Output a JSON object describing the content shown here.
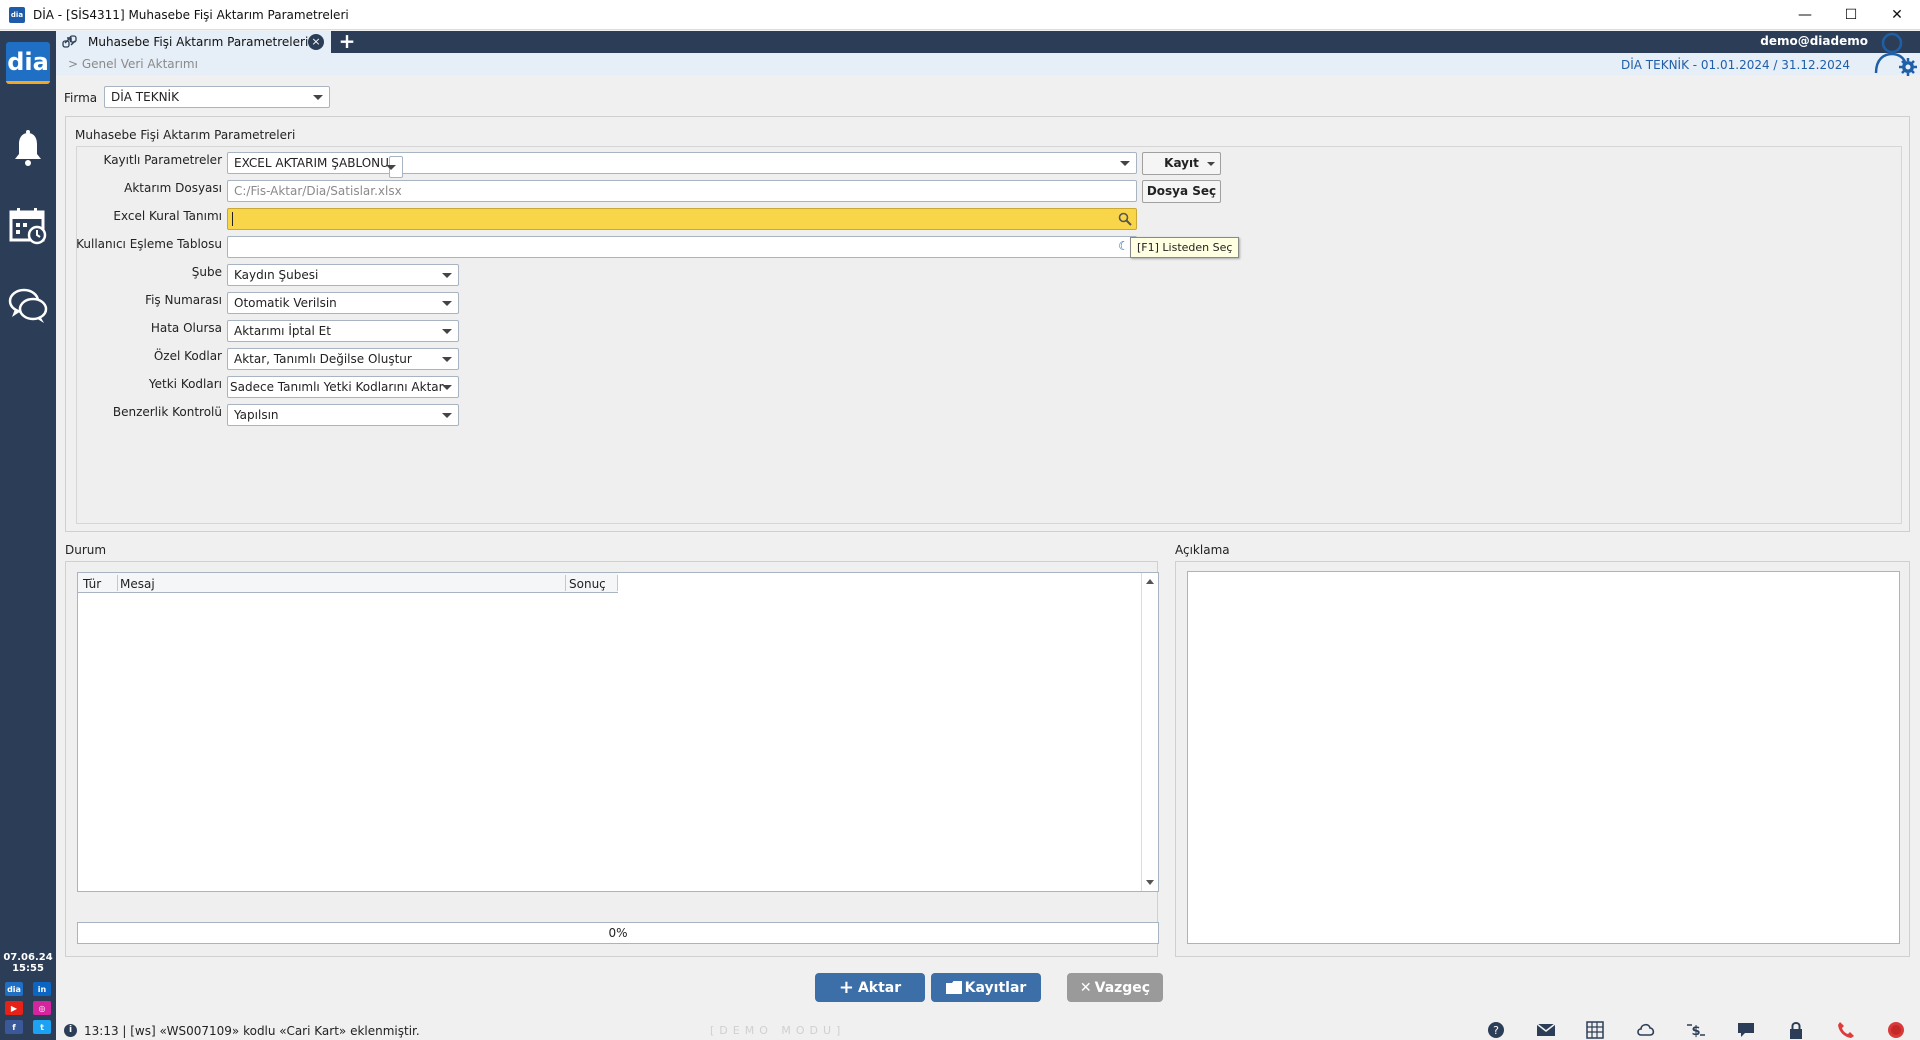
{
  "window": {
    "title": "DİA - [SİS4311] Muhasebe Fişi Aktarım Parametreleri",
    "app_icon_text": "dia",
    "min": "—",
    "max": "☐",
    "close": "✕"
  },
  "sidebar": {
    "logo": "dia",
    "date": "07.06.24",
    "time": "15:55",
    "icons": [
      "bell-icon",
      "calendar-clock-icon",
      "chat-icon"
    ],
    "social": [
      {
        "name": "dia",
        "text": "dia",
        "color": "#1f6fc4"
      },
      {
        "name": "linkedin",
        "text": "in",
        "color": "#0a66c2"
      },
      {
        "name": "youtube",
        "text": "▶",
        "color": "#e62117"
      },
      {
        "name": "instagram",
        "text": "◎",
        "color": "#d6249f"
      },
      {
        "name": "facebook",
        "text": "f",
        "color": "#3b5998"
      },
      {
        "name": "twitter",
        "text": "t",
        "color": "#1da1f2"
      }
    ]
  },
  "tabs": {
    "active_label": "Muhasebe Fişi Aktarım Parametreleri",
    "close": "×",
    "add": "+"
  },
  "user": {
    "name": "demo@diademo"
  },
  "breadcrumb": "> Genel Veri Aktarımı",
  "period": "DİA TEKNİK -  01.01.2024 / 31.12.2024",
  "firma": {
    "label": "Firma",
    "value": "DİA TEKNİK"
  },
  "params": {
    "title": "Muhasebe Fişi Aktarım Parametreleri",
    "kayitli": {
      "label": "Kayıtlı Parametreler",
      "value": "EXCEL AKTARIM ŞABLONU",
      "button": "Kayıt"
    },
    "dosya": {
      "label": "Aktarım Dosyası",
      "placeholder": "C:/Fis-Aktar/Dia/Satislar.xlsx",
      "button": "Dosya Seç"
    },
    "excel_kural": {
      "label": "Excel Kural Tanımı",
      "value": ""
    },
    "kullanici_esleme": {
      "label": "Kullanıcı Eşleme Tablosu",
      "value": ""
    },
    "tooltip": "[F1] Listeden Seç",
    "sube": {
      "label": "Şube",
      "value": "Kaydın Şubesi"
    },
    "fis_no": {
      "label": "Fiş Numarası",
      "value": "Otomatik Verilsin"
    },
    "hata": {
      "label": "Hata Olursa",
      "value": "Aktarımı İptal Et"
    },
    "ozel_kod": {
      "label": "Özel Kodlar",
      "value": "Aktar, Tanımlı Değilse Oluştur"
    },
    "yetki": {
      "label": "Yetki Kodları",
      "value": "Sadece Tanımlı Yetki Kodlarını Aktar"
    },
    "benzerlik": {
      "label": "Benzerlik Kontrolü",
      "value": "Yapılsın"
    }
  },
  "durum": {
    "label": "Durum",
    "columns": [
      "Tür",
      "Mesaj",
      "Sonuç"
    ],
    "rows": [],
    "progress": 0,
    "progress_text": "0%"
  },
  "aciklama": {
    "label": "Açıklama"
  },
  "buttons": {
    "aktar": "Aktar",
    "kayitlar": "Kayıtlar",
    "vazgec": "Vazgeç"
  },
  "statusbar": {
    "message": "13:13 | [ws] «WS007109» kodlu «Cari Kart» eklenmiştir.",
    "demo": "[DEMO MODU]",
    "icons": [
      "help-icon",
      "mail-icon",
      "grid-icon",
      "cloud-sync-icon",
      "currency-icon",
      "chat-icon",
      "lock-icon",
      "phone-icon",
      "record-icon"
    ]
  },
  "colors": {
    "sidebar": "#2c3e57",
    "accent": "#3c6ea8",
    "highlight": "#f9d649"
  }
}
